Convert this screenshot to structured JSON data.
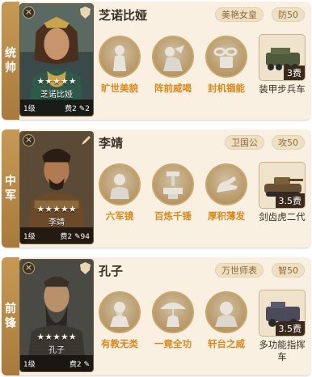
{
  "colors": {
    "card_bg": "#f9f0e1",
    "position_tab": "#b88a48",
    "skill_label": "#d98a1e",
    "tag_bg": "#efe0c4",
    "tag_text": "#8a6a3c"
  },
  "cards": [
    {
      "position_label": [
        "统",
        "帅"
      ],
      "hero_name": "芝诺比娅",
      "portrait_name": "芝诺比娅",
      "stars": "★★★★★",
      "level": "1级",
      "cost": "费2",
      "extra_count": "2",
      "tags": [
        "美艳女皇",
        "防50"
      ],
      "skills": [
        {
          "label": "旷世美貌",
          "icon": "female-statue-icon"
        },
        {
          "label": "阵前威喝",
          "icon": "shouting-warrior-icon"
        },
        {
          "label": "封机锢能",
          "icon": "chain-lock-icon"
        }
      ],
      "troop": {
        "name": "装甲步兵车",
        "cost": "3费",
        "icon": "armored-vehicle-icon"
      }
    },
    {
      "position_label": [
        "中",
        "军"
      ],
      "hero_name": "李靖",
      "portrait_name": "李靖",
      "stars": "★★★★★",
      "level": "1级",
      "cost": "费2",
      "extra_count": "94",
      "tags": [
        "卫国公",
        "攻50"
      ],
      "skills": [
        {
          "label": "六军镜",
          "icon": "general-bust-icon"
        },
        {
          "label": "百炼千锤",
          "icon": "anvil-hammer-icon"
        },
        {
          "label": "厚积薄发",
          "icon": "open-hand-icon"
        }
      ],
      "troop": {
        "name": "剑齿虎二代",
        "cost": "3.5费",
        "icon": "tank-icon"
      }
    },
    {
      "position_label": [
        "前",
        "锋"
      ],
      "hero_name": "孔子",
      "portrait_name": "孔子",
      "stars": "★★★★★",
      "level": "1级",
      "cost": "费2",
      "extra_count": "",
      "tags": [
        "万世师表",
        "智50"
      ],
      "skills": [
        {
          "label": "有教无类",
          "icon": "sage-bust-icon"
        },
        {
          "label": "一竟全功",
          "icon": "umbrella-figure-icon"
        },
        {
          "label": "轩台之威",
          "icon": "bald-sage-icon"
        }
      ],
      "troop": {
        "name": "多功能指挥车",
        "cost": "3.5费",
        "icon": "command-vehicle-icon"
      }
    }
  ]
}
